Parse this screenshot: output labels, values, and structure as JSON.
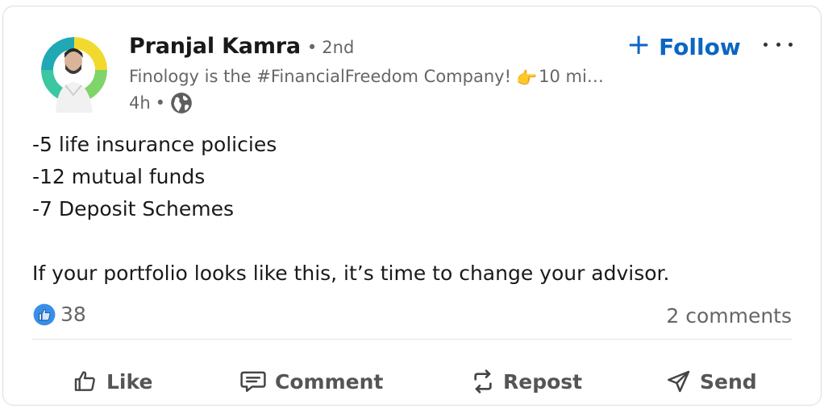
{
  "post": {
    "author": {
      "name": "Pranjal Kamra",
      "connection_degree": "2nd",
      "headline": "Finology is the #FinancialFreedom Company!",
      "headline_emoji": "👉",
      "headline_tail": "10 mi…",
      "time_ago": "4h",
      "visibility_icon": "globe-icon"
    },
    "follow_label": "Follow",
    "body_lines": [
      "-5 life insurance policies",
      "-12 mutual funds",
      "-7 Deposit Schemes",
      "",
      "If your portfolio looks like this, it’s time to change your advisor."
    ],
    "reactions": {
      "icon": "like-reaction-icon",
      "count": "38"
    },
    "comments_count": "2 comments",
    "actions": [
      {
        "label": "Like",
        "icon": "thumbs-up-icon"
      },
      {
        "label": "Comment",
        "icon": "comment-icon"
      },
      {
        "label": "Repost",
        "icon": "repost-icon"
      },
      {
        "label": "Send",
        "icon": "send-icon"
      }
    ],
    "colors": {
      "accent": "#0a66c2",
      "text": "#191919",
      "muted": "#666666"
    }
  }
}
